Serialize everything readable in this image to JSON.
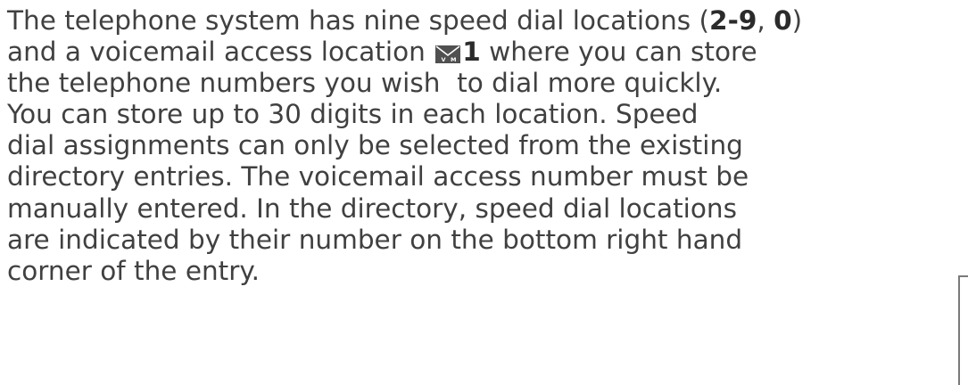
{
  "paragraph": {
    "line1": {
      "text_a": "The telephone system has nine speed dial locations (",
      "key_range": "2-9",
      "sep": ", ",
      "key_zero": "0",
      "close": ")"
    },
    "line2": {
      "text_a": "and a voicemail access location ",
      "vm_icon": "voicemail-envelope-icon",
      "vm_key": "1",
      "text_b": " where you can store"
    },
    "line3": "the telephone numbers you wish  to dial more quickly.",
    "line4": "You can store up to 30 digits in each location. Speed",
    "line5": "dial assignments can only be selected from the existing",
    "line6": "directory entries. The voicemail access number must be",
    "line7": "manually entered. In the directory, speed dial locations",
    "line8": "are indicated by their number on the bottom right hand",
    "line9": "corner of the entry."
  },
  "colors": {
    "text": "#404040",
    "icon": "#505050",
    "frame": "#7a7a7a"
  }
}
